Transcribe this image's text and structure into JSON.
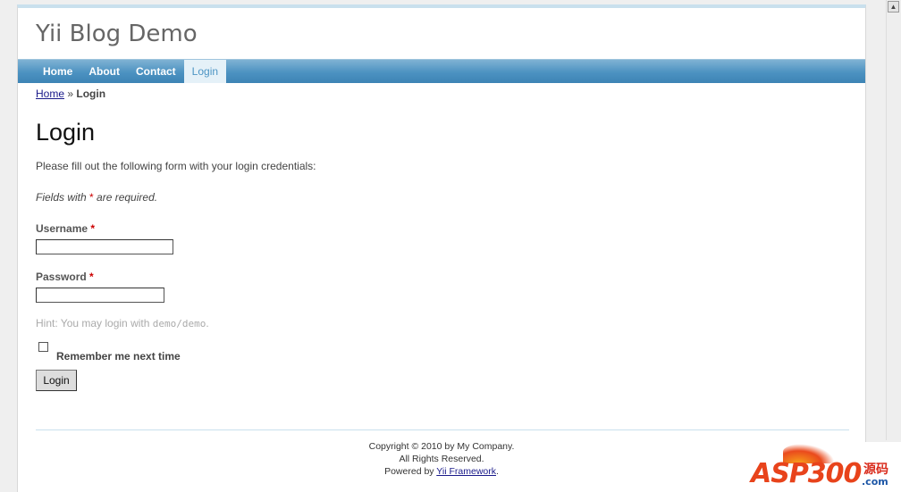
{
  "header": {
    "logo": "Yii Blog Demo"
  },
  "menu": {
    "items": [
      {
        "label": "Home"
      },
      {
        "label": "About"
      },
      {
        "label": "Contact"
      },
      {
        "label": "Login"
      }
    ],
    "active": "Login"
  },
  "breadcrumbs": {
    "home": "Home",
    "separator": "»",
    "current": "Login"
  },
  "main": {
    "title": "Login",
    "intro": "Please fill out the following form with your login credentials:",
    "note_prefix": "Fields with ",
    "note_star": "*",
    "note_suffix": " are required.",
    "username": {
      "label": "Username",
      "star": "*",
      "value": ""
    },
    "password": {
      "label": "Password",
      "star": "*",
      "value": ""
    },
    "hint_prefix": "Hint: You may login with ",
    "hint_code": "demo/demo",
    "hint_suffix": ".",
    "remember_label": "Remember me next time",
    "remember_checked": false,
    "submit_label": "Login"
  },
  "footer": {
    "copyright": "Copyright © 2010 by My Company.",
    "rights": "All Rights Reserved.",
    "powered_prefix": "Powered by ",
    "powered_link": "Yii Framework",
    "powered_suffix": "."
  },
  "watermark": {
    "brand": "ASP300",
    "cn": "源码",
    "com": ".com"
  },
  "colors": {
    "menu_bar": "#4c92c1",
    "menu_active_bg": "#e5f1f8",
    "required": "#cc0000",
    "watermark": "#e8431b"
  }
}
